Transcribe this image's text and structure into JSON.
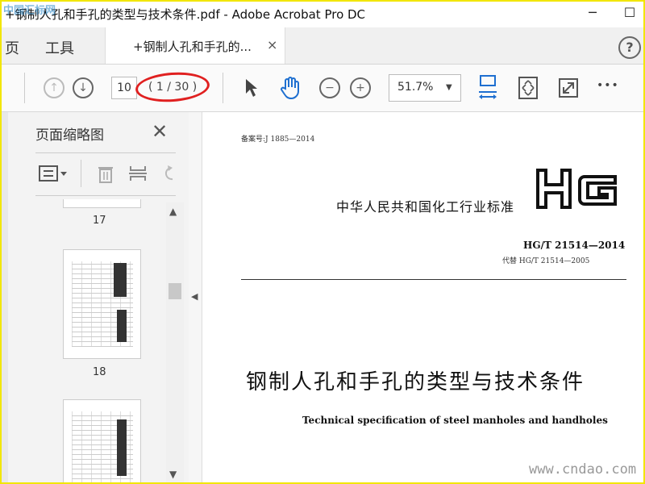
{
  "window": {
    "title": "+钢制人孔和手孔的类型与技术条件.pdf - Adobe Acrobat Pro DC",
    "minimize_glyph": "─",
    "maximize_glyph": "☐",
    "watermark_top": "中国汇标网"
  },
  "nav": {
    "home_label": "页",
    "tools_label": "工具",
    "tab_label": "+钢制人孔和手孔的...",
    "tab_close": "×",
    "help_glyph": "?"
  },
  "toolbar": {
    "prev_page_icon": "up-arrow-circle-icon",
    "next_page_icon": "down-arrow-circle-icon",
    "current_page": "10",
    "page_count": "( 1 / 30 )",
    "zoom_value": "51.7%",
    "more_glyph": "•••",
    "highlight_color": "#e02020",
    "accent_color": "#1e6fd0"
  },
  "sidebar": {
    "title": "页面缩略图",
    "close_glyph": "✕",
    "thumbnails": [
      {
        "label": "17"
      },
      {
        "label": "18"
      }
    ]
  },
  "document": {
    "record_no": "备案号:J 1885—2014",
    "standard_name": "中华人民共和国化工行业标准",
    "logo_text": "HG",
    "code": "HG/T 21514—2014",
    "replaces": "代替 HG/T 21514—2005",
    "title_cn": "钢制人孔和手孔的类型与技术条件",
    "title_en": "Technical specification of steel manholes and handholes"
  },
  "watermark_bottom": "www.cndao.com"
}
